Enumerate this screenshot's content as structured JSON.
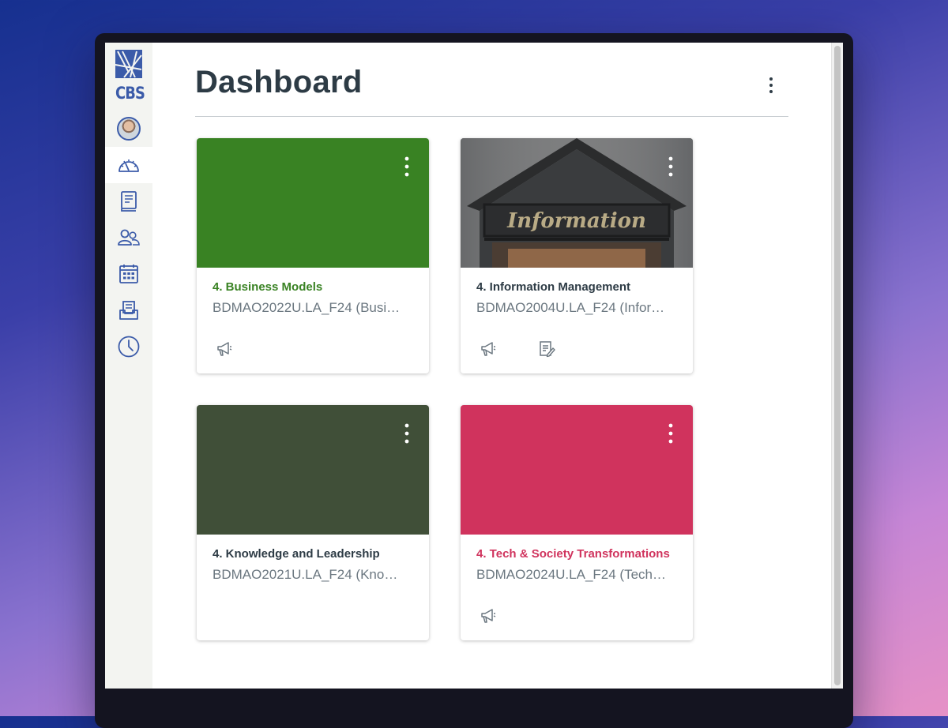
{
  "app": {
    "logo_text": "CBS"
  },
  "page": {
    "title": "Dashboard"
  },
  "courses": [
    {
      "title": "4. Business Models",
      "code": "BDMAO2022U.LA_F24 (Busi…",
      "color": "#398223",
      "title_color": "#398223",
      "icons": [
        "announcement-icon"
      ]
    },
    {
      "title": "4. Information Management",
      "code": "BDMAO2004U.LA_F24 (Infor…",
      "color": "#6f7072",
      "title_color": "#2d3b45",
      "image_text": "Information",
      "icons": [
        "announcement-icon",
        "assignment-icon"
      ]
    },
    {
      "title": "4. Knowledge and Leadership",
      "code": "BDMAO2021U.LA_F24 (Kno…",
      "color": "#404f38",
      "title_color": "#2d3b45",
      "icons": []
    },
    {
      "title": "4. Tech & Society Transformations",
      "code": "BDMAO2024U.LA_F24 (Tech…",
      "color": "#d0335d",
      "title_color": "#d0335d",
      "icons": [
        "announcement-icon"
      ]
    }
  ],
  "colors": {
    "brand": "#3b5ba9",
    "heading": "#2d3b45",
    "muted": "#6b7780"
  }
}
